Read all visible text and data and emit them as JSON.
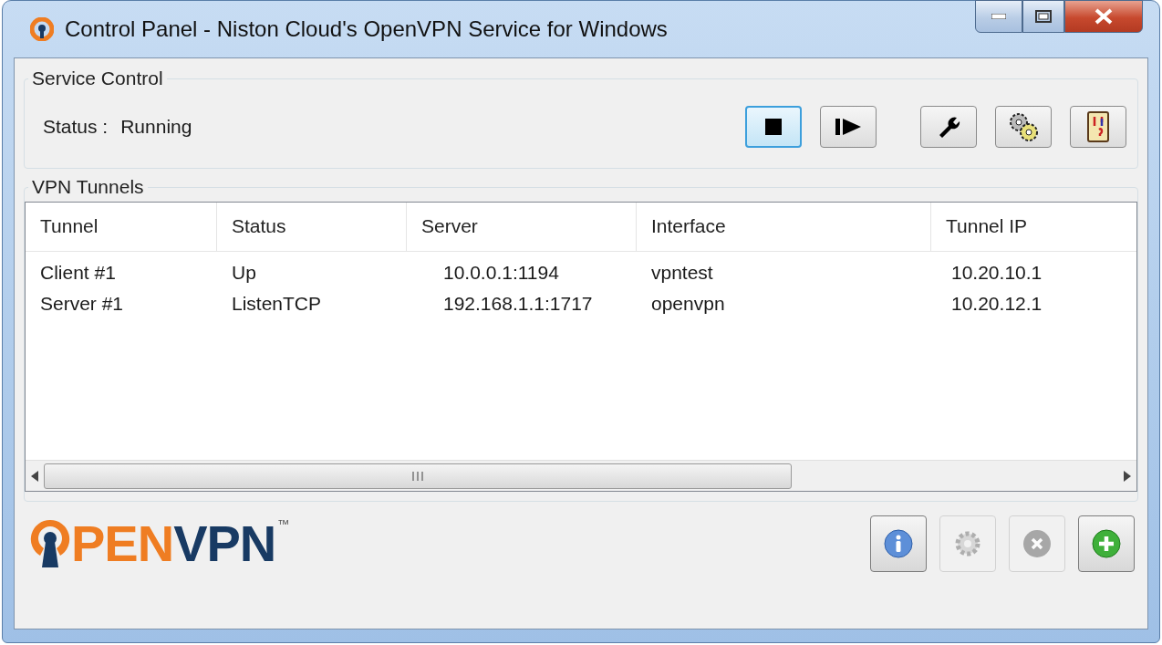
{
  "window": {
    "title": "Control Panel - Niston Cloud's OpenVPN Service for Windows"
  },
  "service_control": {
    "title": "Service Control",
    "status_label": "Status :",
    "status_value": "Running",
    "buttons": [
      {
        "kind": "stop",
        "focused": true
      },
      {
        "kind": "step",
        "focused": false
      },
      {
        "kind": "wrench",
        "focused": false
      },
      {
        "kind": "gears",
        "focused": false
      },
      {
        "kind": "notebook",
        "focused": false
      }
    ]
  },
  "vpn_tunnels": {
    "title": "VPN Tunnels",
    "columns": [
      "Tunnel",
      "Status",
      "Server",
      "Interface",
      "Tunnel IP"
    ],
    "rows": [
      [
        "Client #1",
        "Up",
        "10.0.0.1:1194",
        "vpntest",
        "10.20.10.1"
      ],
      [
        "Server #1",
        "ListenTCP",
        "192.168.1.1:1717",
        "openvpn",
        "10.20.12.1"
      ]
    ]
  },
  "logo": {
    "orange_text": "PEN",
    "blue_text": "VPN",
    "mark": "™"
  },
  "bottom_buttons": [
    {
      "kind": "info",
      "disabled": false
    },
    {
      "kind": "gear",
      "disabled": true
    },
    {
      "kind": "remove",
      "disabled": true
    },
    {
      "kind": "add",
      "disabled": false
    }
  ]
}
